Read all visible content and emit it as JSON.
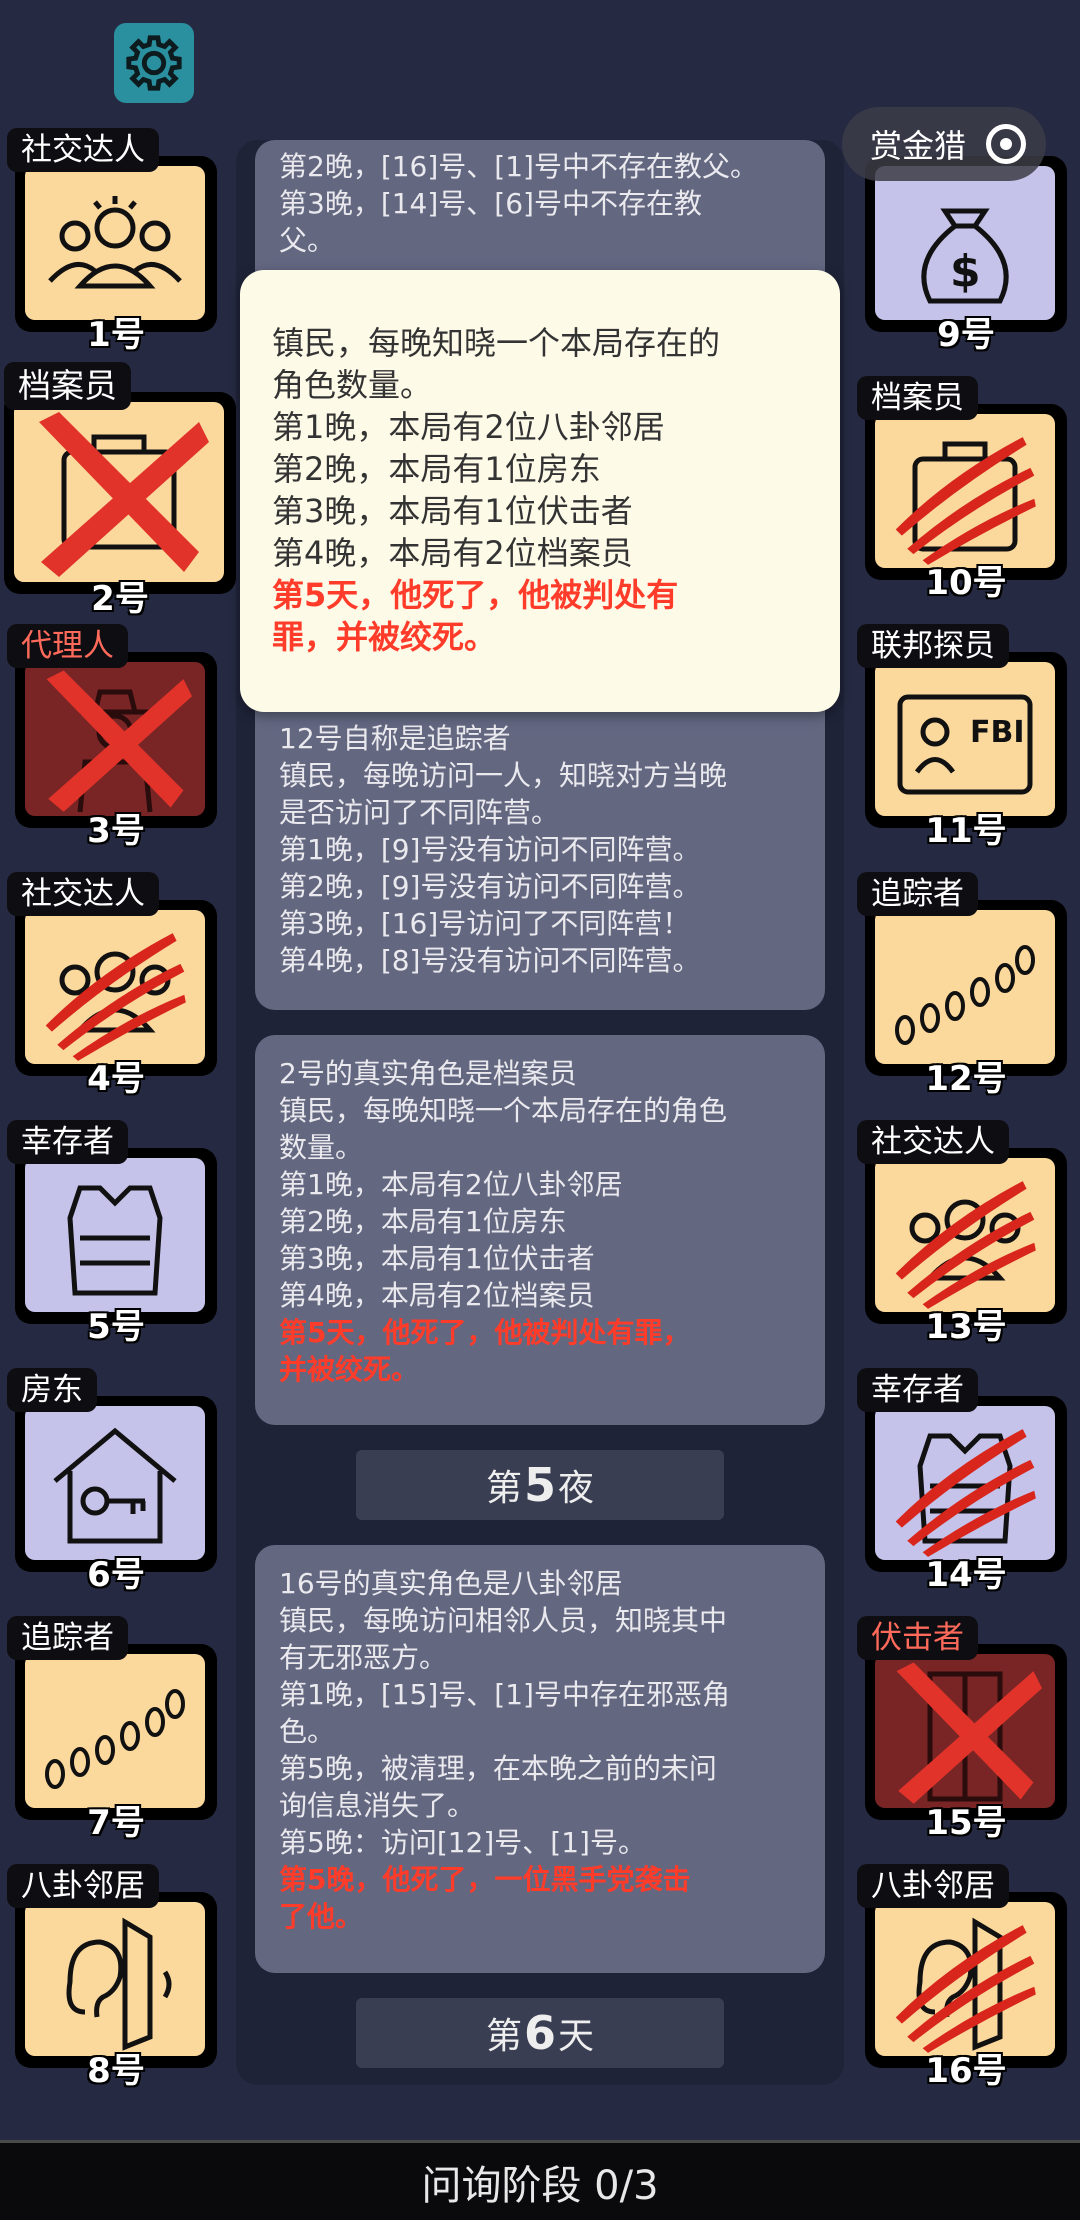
{
  "capsule": {
    "label": "赏金猎"
  },
  "left_slots": [
    {
      "role": "社交达人",
      "num": "1号"
    },
    {
      "role": "档案员",
      "num": "2号"
    },
    {
      "role": "代理人",
      "num": "3号"
    },
    {
      "role": "社交达人",
      "num": "4号"
    },
    {
      "role": "幸存者",
      "num": "5号"
    },
    {
      "role": "房东",
      "num": "6号"
    },
    {
      "role": "追踪者",
      "num": "7号"
    },
    {
      "role": "八卦邻居",
      "num": "8号"
    }
  ],
  "right_slots": [
    {
      "role": "",
      "num": "9号"
    },
    {
      "role": "档案员",
      "num": "10号"
    },
    {
      "role": "联邦探员",
      "num": "11号"
    },
    {
      "role": "追踪者",
      "num": "12号"
    },
    {
      "role": "社交达人",
      "num": "13号"
    },
    {
      "role": "幸存者",
      "num": "14号"
    },
    {
      "role": "伏击者",
      "num": "15号"
    },
    {
      "role": "八卦邻居",
      "num": "16号"
    }
  ],
  "top_card": {
    "lines": [
      "第2晚，[16]号、[1]号中不存在教父。",
      "第3晚，[14]号、[6]号中不存在教",
      "父。"
    ]
  },
  "popup": {
    "lines": [
      "镇民，每晚知晓一个本局存在的",
      "角色数量。",
      "第1晚，本局有2位八卦邻居",
      "第2晚，本局有1位房东",
      "第3晚，本局有1位伏击者",
      "第4晚，本局有2位档案员"
    ],
    "red_lines": [
      "第5天，他死了，他被判处有",
      "罪，并被绞死。"
    ]
  },
  "card_tracker": {
    "lines": [
      "12号自称是追踪者",
      "镇民，每晚访问一人，知晓对方当晚",
      "是否访问了不同阵营。",
      "第1晚，[9]号没有访问不同阵营。",
      "第2晚，[9]号没有访问不同阵营。",
      "第3晚，[16]号访问了不同阵营！",
      "第4晚，[8]号没有访问不同阵营。"
    ]
  },
  "card_archivist": {
    "lines": [
      "2号的真实角色是档案员",
      "镇民，每晚知晓一个本局存在的角色",
      "数量。",
      "第1晚，本局有2位八卦邻居",
      "第2晚，本局有1位房东",
      "第3晚，本局有1位伏击者",
      "第4晚，本局有2位档案员"
    ],
    "red_lines": [
      "第5天，他死了，他被判处有罪，",
      "并被绞死。"
    ]
  },
  "phase_night5": {
    "prefix": "第",
    "number": "5",
    "suffix": "夜"
  },
  "card_gossip": {
    "lines": [
      "16号的真实角色是八卦邻居",
      "镇民，每晚访问相邻人员，知晓其中",
      "有无邪恶方。",
      "第1晚，[15]号、[1]号中存在邪恶角",
      "色。",
      "第5晚，被清理，在本晚之前的未问",
      "询信息消失了。",
      "第5晚：访问[12]号、[1]号。"
    ],
    "red_lines": [
      "第5晚，他死了，一位黑手党袭击",
      "了他。"
    ]
  },
  "phase_day6": {
    "prefix": "第",
    "number": "6",
    "suffix": "天"
  },
  "bottom_bar": {
    "label": "问询阶段 0/3"
  },
  "colors": {
    "background": "#252a42",
    "card": "#636780",
    "popup": "#fdfae8",
    "death_text": "#ff3b2a",
    "tile_yellow": "#fbd99c",
    "tile_lavender": "#c5c3ea",
    "tile_evil": "#7a2525"
  }
}
